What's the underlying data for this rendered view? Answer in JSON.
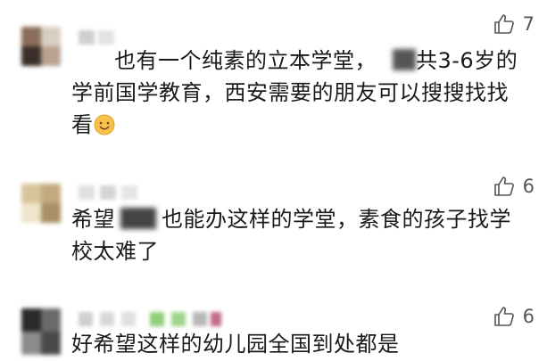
{
  "comments": [
    {
      "text_line1_before": "也有一个纯素的立本学堂，",
      "text_line1_after": "共3-6岁的",
      "text_line2": "学前国学教育，西安需要的朋友可以搜搜找找",
      "text_line3": "看",
      "emoji": "smiling-face-emoji",
      "likes": "7"
    },
    {
      "text_line1_before": "希望",
      "text_line1_after": "也能办这样的学堂，素食的孩子找学",
      "text_line2": "校太难了",
      "likes": "6"
    },
    {
      "text_line1": "好希望这样的幼儿园全国到处都是",
      "likes": "6"
    }
  ],
  "icons": {
    "like": "thumbs-up-icon"
  },
  "colors": {
    "text": "#1a1a1a",
    "like_icon": "#555555",
    "background": "#ffffff"
  }
}
